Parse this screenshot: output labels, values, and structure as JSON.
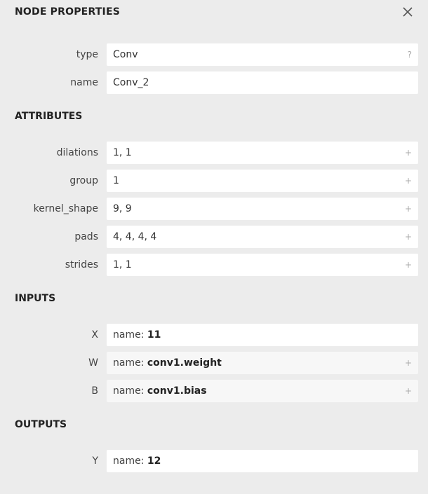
{
  "header": {
    "title": "NODE PROPERTIES"
  },
  "node": {
    "rows": [
      {
        "label": "type",
        "value": "Conv",
        "button": "?"
      },
      {
        "label": "name",
        "value": "Conv_2"
      }
    ]
  },
  "attributes": {
    "title": "ATTRIBUTES",
    "rows": [
      {
        "label": "dilations",
        "value": "1, 1",
        "button": "+"
      },
      {
        "label": "group",
        "value": "1",
        "button": "+"
      },
      {
        "label": "kernel_shape",
        "value": "9, 9",
        "button": "+"
      },
      {
        "label": "pads",
        "value": "4, 4, 4, 4",
        "button": "+"
      },
      {
        "label": "strides",
        "value": "1, 1",
        "button": "+"
      }
    ]
  },
  "inputs": {
    "title": "INPUTS",
    "rows": [
      {
        "label": "X",
        "key": "name:",
        "value": "11"
      },
      {
        "label": "W",
        "key": "name:",
        "value": "conv1.weight",
        "button": "+"
      },
      {
        "label": "B",
        "key": "name:",
        "value": "conv1.bias",
        "button": "+"
      }
    ]
  },
  "outputs": {
    "title": "OUTPUTS",
    "rows": [
      {
        "label": "Y",
        "key": "name:",
        "value": "12"
      }
    ]
  },
  "colors": {
    "background": "#ececec",
    "field": "#ffffff",
    "field_alt": "#f7f7f7",
    "text": "#222222"
  }
}
